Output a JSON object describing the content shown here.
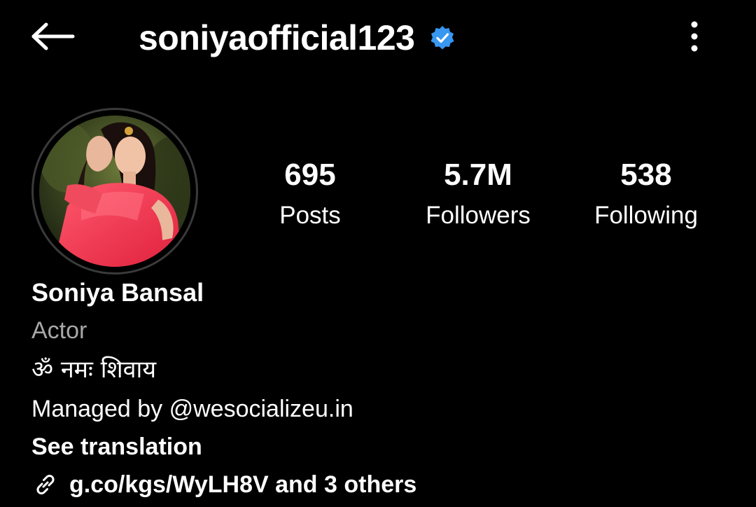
{
  "header": {
    "username": "soniyaofficial123",
    "back_icon": "back-arrow-icon",
    "verified_icon": "verified-badge-icon",
    "more_icon": "more-vertical-icon",
    "verified_color": "#3897f0"
  },
  "profile": {
    "avatar_icon": "profile-photo"
  },
  "stats": {
    "posts": {
      "value": "695",
      "label": "Posts"
    },
    "followers": {
      "value": "5.7M",
      "label": "Followers"
    },
    "following": {
      "value": "538",
      "label": "Following"
    }
  },
  "bio": {
    "name": "Soniya Bansal",
    "category": "Actor",
    "text": "ॐ नमः शिवाय",
    "managed_prefix": "Managed by ",
    "managed_handle": "@wesocializeu.in",
    "see_translation": "See translation",
    "link_text": "g.co/kgs/WyLH8V and 3 others",
    "link_icon": "link-icon"
  },
  "colors": {
    "background": "#000000",
    "text": "#ffffff",
    "secondary_text": "#a8a8a8"
  }
}
